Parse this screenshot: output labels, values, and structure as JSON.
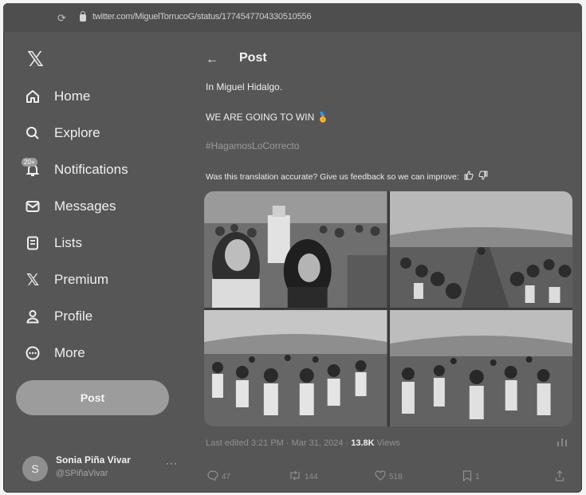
{
  "browser": {
    "url": "twitter.com/MiguelTorrucoG/status/1774547704330510556"
  },
  "sidebar": {
    "logo": "𝕏",
    "items": [
      {
        "label": "Home",
        "icon": "home-icon"
      },
      {
        "label": "Explore",
        "icon": "search-icon"
      },
      {
        "label": "Notifications",
        "icon": "bell-icon",
        "badge": "20+"
      },
      {
        "label": "Messages",
        "icon": "mail-icon"
      },
      {
        "label": "Lists",
        "icon": "list-icon"
      },
      {
        "label": "Premium",
        "icon": "x-logo-icon"
      },
      {
        "label": "Profile",
        "icon": "person-icon"
      },
      {
        "label": "More",
        "icon": "more-circle-icon"
      }
    ],
    "post_button": "Post",
    "account": {
      "initial": "S",
      "name": "Sonia Piña Vivar",
      "handle": "@SPiñaVivar",
      "more": "···"
    }
  },
  "main": {
    "header_title": "Post",
    "text_line1": "In Miguel Hidalgo.",
    "text_line2": "WE ARE GOING TO WIN 🏅",
    "hashtag": "#HagamosLoCorrecto",
    "feedback": "Was this translation accurate? Give us feedback so we can improve:",
    "timestamp": "Last edited 3:21 PM · Mar 31, 2024 · ",
    "views_count": "13.8K",
    "views_label": " Views",
    "actions": {
      "replies": "47",
      "reposts": "144",
      "likes": "518",
      "bookmarks": "1"
    }
  },
  "colors": {
    "background": "#565656",
    "text": "#efefef",
    "muted": "#909090",
    "post_button": "#9c9c9c"
  }
}
